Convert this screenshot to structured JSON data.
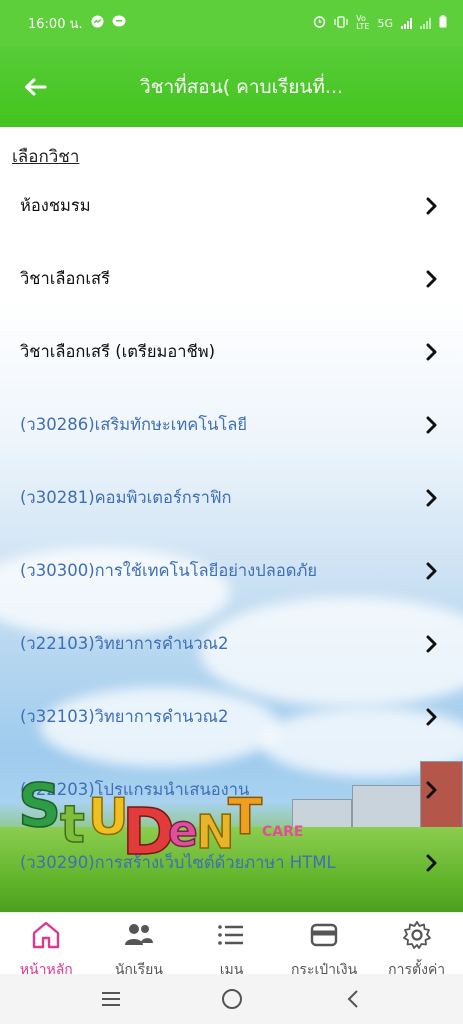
{
  "status_bar": {
    "time": "16:00 น.",
    "network": "5G"
  },
  "app_bar": {
    "title": "วิชาที่สอน( คาบเรียนที่..."
  },
  "section": {
    "label": "เลือกวิชา"
  },
  "subjects": [
    {
      "label": "ห้องชมรม",
      "color": "#111111"
    },
    {
      "label": "วิชาเลือกเสรี",
      "color": "#111111"
    },
    {
      "label": "วิชาเลือกเสรี (เตรียมอาชีพ)",
      "color": "#111111"
    },
    {
      "label": "(ว30286)เสริมทักษะเทคโนโลยี",
      "color": "#3f6fb5"
    },
    {
      "label": "(ว30281)คอมพิวเตอร์กราฟิก",
      "color": "#3f6fb5"
    },
    {
      "label": "(ว30300)การใช้เทคโนโลยีอย่างปลอดภัย",
      "color": "#3f6fb5"
    },
    {
      "label": "(ว22103)วิทยาการคำนวณ2",
      "color": "#3f6fb5"
    },
    {
      "label": "(ว32103)วิทยาการคำนวณ2",
      "color": "#3f6fb5"
    },
    {
      "label": "(ว22203)โปรแกรมนำเสนองาน",
      "color": "#3f6fb5"
    },
    {
      "label": "(ว30290)การสร้างเว็บไซต์ด้วยภาษา HTML",
      "color": "#3f6fb5"
    }
  ],
  "logo": {
    "text_student": "STUDENT",
    "text_care": "CARE"
  },
  "bottom_nav": [
    {
      "label": "หน้าหลัก",
      "icon": "home-icon",
      "active": true
    },
    {
      "label": "นักเรียน",
      "icon": "people-icon",
      "active": false
    },
    {
      "label": "เมนู",
      "icon": "list-icon",
      "active": false
    },
    {
      "label": "กระเป๋าเงิน",
      "icon": "wallet-icon",
      "active": false
    },
    {
      "label": "การตั้งค่า",
      "icon": "gear-icon",
      "active": false
    }
  ],
  "colors": {
    "appbar": "#4fc92c",
    "active_nav": "#e0388f"
  }
}
